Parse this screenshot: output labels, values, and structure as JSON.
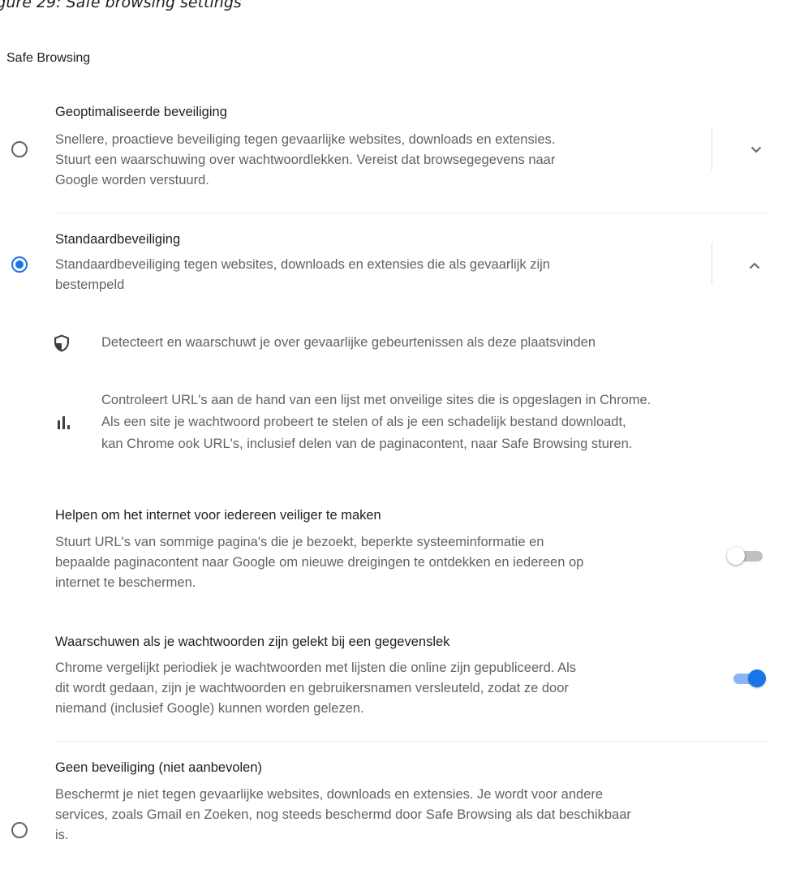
{
  "caption": "igure 29: Safe browsing settings",
  "section_title": "Safe Browsing",
  "options": {
    "enhanced": {
      "title": "Geoptimaliseerde beveiliging",
      "desc": [
        "Snellere, proactieve beveiliging tegen gevaarlijke websites, downloads en extensies.",
        "Stuurt een waarschuwing over wachtwoordlekken. Vereist dat browsegegevens naar",
        "Google worden verstuurd."
      ],
      "selected": false,
      "expanded": false
    },
    "standard": {
      "title": "Standaardbeveiliging",
      "desc": [
        "Standaardbeveiliging tegen websites, downloads en extensies die als gevaarlijk zijn",
        "bestempeld"
      ],
      "selected": true,
      "expanded": true,
      "features": [
        {
          "icon": "shield-icon",
          "text": [
            "Detecteert en waarschuwt je over gevaarlijke gebeurtenissen als deze plaatsvinden"
          ]
        },
        {
          "icon": "bar-chart-icon",
          "text": [
            "Controleert URL's aan de hand van een lijst met onveilige sites die is opgeslagen in Chrome.",
            "Als een site je wachtwoord probeert te stelen of als je een schadelijk bestand downloadt,",
            "kan Chrome ook URL's, inclusief delen van de paginacontent, naar Safe Browsing sturen."
          ]
        }
      ],
      "toggles": [
        {
          "title": "Helpen om het internet voor iedereen veiliger te maken",
          "desc": [
            "Stuurt URL's van sommige pagina's die je bezoekt, beperkte systeeminformatie en",
            "bepaalde paginacontent naar Google om nieuwe dreigingen te ontdekken en iedereen op",
            "internet te beschermen."
          ],
          "on": false
        },
        {
          "title": "Waarschuwen als je wachtwoorden zijn gelekt bij een gegevenslek",
          "desc": [
            "Chrome vergelijkt periodiek je wachtwoorden met lijsten die online zijn gepubliceerd. Als",
            "dit wordt gedaan, zijn je wachtwoorden en gebruikersnamen versleuteld, zodat ze door",
            "niemand (inclusief Google) kunnen worden gelezen."
          ],
          "on": true
        }
      ]
    },
    "none": {
      "title": "Geen beveiliging (niet aanbevolen)",
      "desc": [
        "Beschermt je niet tegen gevaarlijke websites, downloads en extensies. Je wordt voor andere",
        "services, zoals Gmail en Zoeken, nog steeds beschermd door Safe Browsing als dat beschikbaar",
        "is."
      ],
      "selected": false
    }
  },
  "colors": {
    "accent": "#1a73e8",
    "toggle_track_on": "#8ab4f8",
    "toggle_track_off": "#bdc1c6",
    "secondary_text": "#5f6368"
  }
}
